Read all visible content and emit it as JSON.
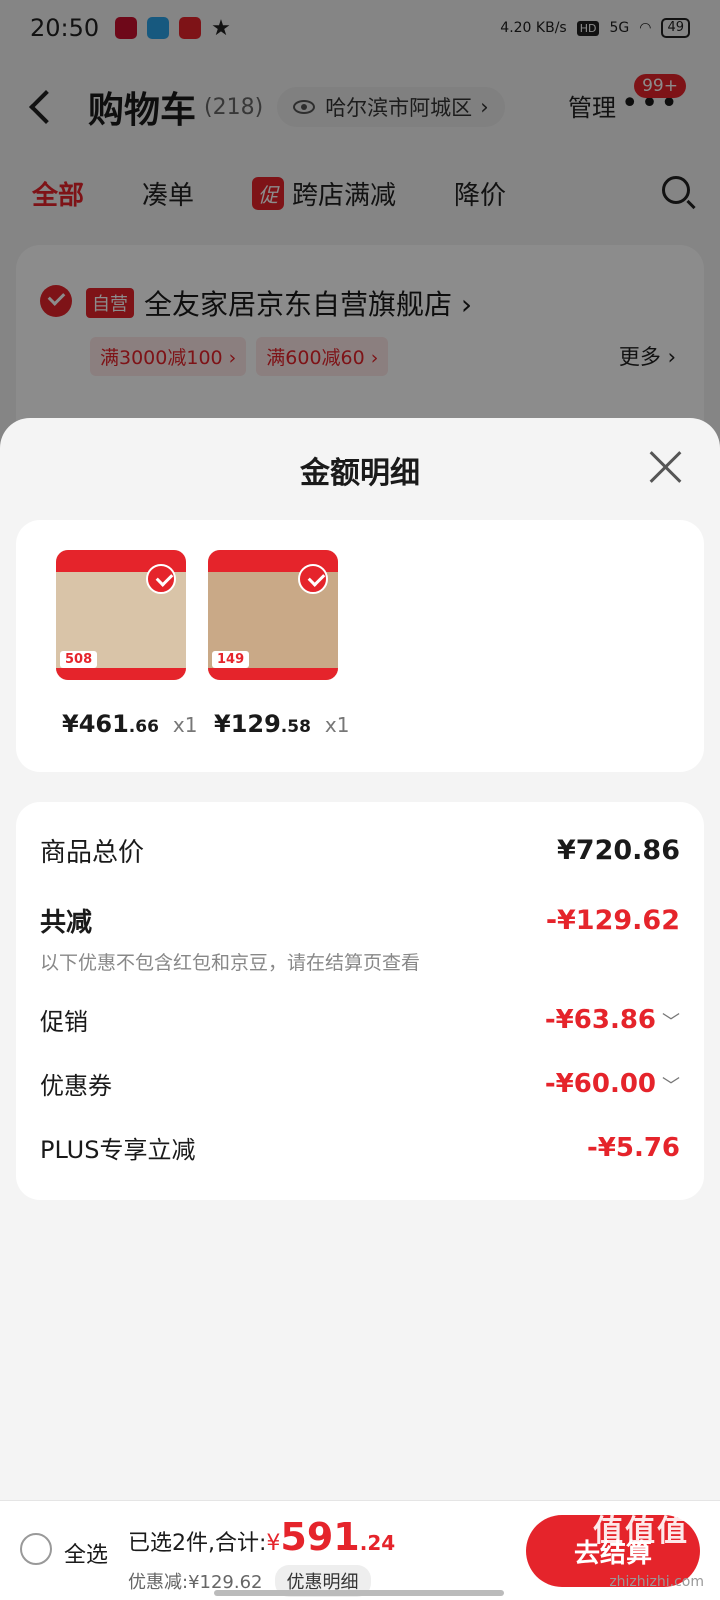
{
  "status": {
    "time": "20:50",
    "net_speed": "4.20 KB/s",
    "hd": "HD",
    "signal": "5G",
    "battery": "49"
  },
  "header": {
    "title": "购物车",
    "count": "(218)",
    "location": "哈尔滨市阿城区",
    "manage": "管理",
    "more": "•••",
    "badge": "99+"
  },
  "tabs": [
    {
      "label": "全部"
    },
    {
      "label": "凑单"
    },
    {
      "label": "跨店满减",
      "tag": "促"
    },
    {
      "label": "降价"
    }
  ],
  "store": {
    "tag": "自营",
    "name": "全友家居京东自营旗舰店 ›",
    "coupons": [
      "满3000减100 ›",
      "满600减60 ›"
    ],
    "more": "更多 ›"
  },
  "sheet": {
    "title": "金额明细",
    "products": [
      {
        "price_int": "¥461",
        "price_dec": ".66",
        "qty": "x1",
        "img_tag": "508",
        "img_color": "#d9c4a8"
      },
      {
        "price_int": "¥129",
        "price_dec": ".58",
        "qty": "x1",
        "img_tag": "149",
        "img_color": "#c9a987"
      }
    ],
    "details": {
      "total_label": "商品总价",
      "total_value": "¥720.86",
      "reduce_label": "共减",
      "reduce_value": "-¥129.62",
      "note": "以下优惠不包含红包和京豆，请在结算页查看",
      "promo_label": "促销",
      "promo_value": "-¥63.86",
      "coupon_label": "优惠券",
      "coupon_value": "-¥60.00",
      "plus_label": "PLUS专享立减",
      "plus_value": "-¥5.76"
    }
  },
  "bottom": {
    "select_all": "全选",
    "selected_label": "已选2件,合计:",
    "currency": "¥",
    "total_int": "591",
    "total_dec": ".24",
    "discount": "优惠减:¥129.62",
    "discount_detail": "优惠明细",
    "checkout": "去结算",
    "watermark": "值值值",
    "watermark_url": "zhizhizhi.com"
  },
  "colors": {
    "accent": "#e5242b"
  }
}
